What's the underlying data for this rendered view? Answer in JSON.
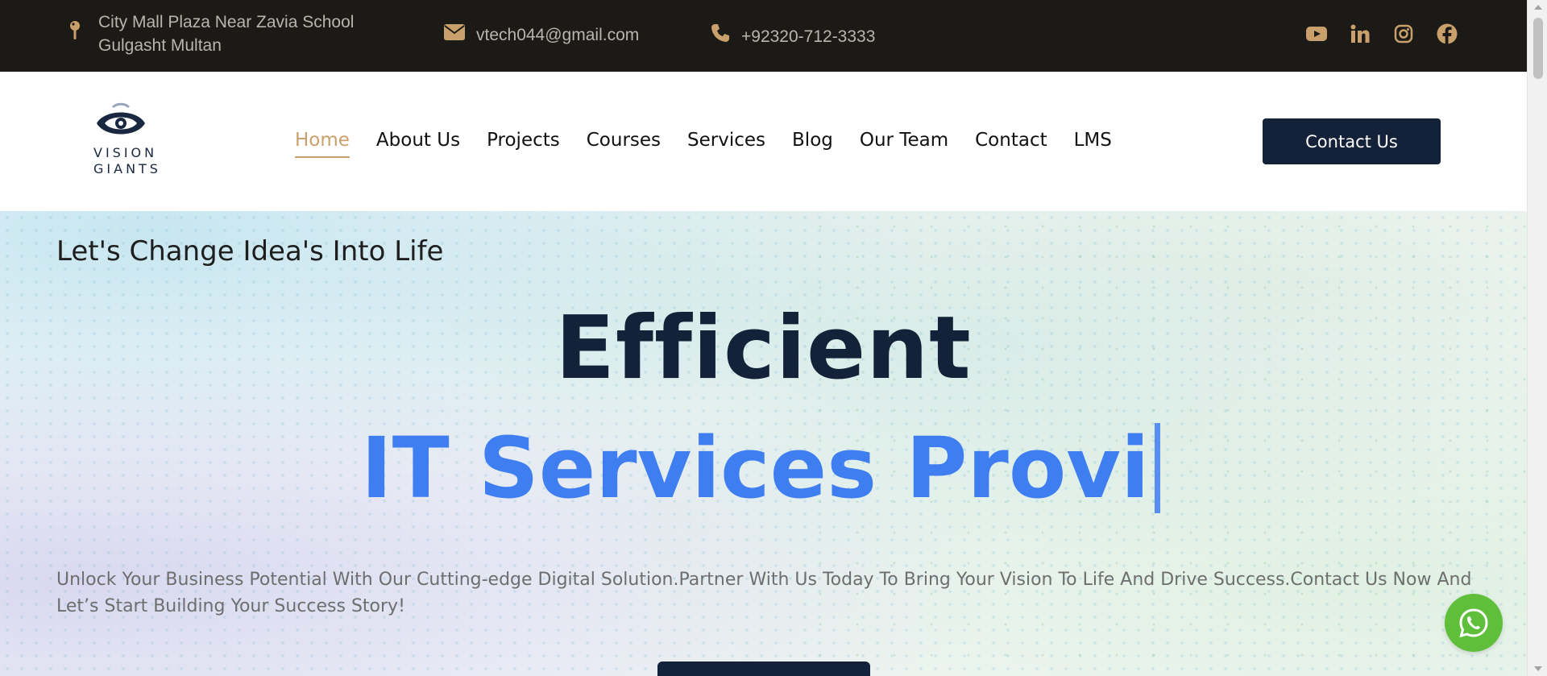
{
  "topbar": {
    "address_line1": "City Mall Plaza Near Zavia School",
    "address_line2": "Gulgasht Multan",
    "email": "vtech044@gmail.com",
    "phone": "+92320-712-3333",
    "social_icons": [
      "youtube-icon",
      "linkedin-icon",
      "instagram-icon",
      "facebook-icon"
    ],
    "icon_color": "#c9a06b",
    "background": "#1b1a17"
  },
  "header": {
    "logo_line1": "VISION",
    "logo_line2": "GIANTS",
    "nav": [
      {
        "label": "Home",
        "active": true
      },
      {
        "label": "About Us"
      },
      {
        "label": "Projects"
      },
      {
        "label": "Courses"
      },
      {
        "label": "Services"
      },
      {
        "label": "Blog"
      },
      {
        "label": "Our Team"
      },
      {
        "label": "Contact"
      },
      {
        "label": "LMS"
      }
    ],
    "cta_label": "Contact Us",
    "active_color": "#c9a06b",
    "brand_color": "#132238"
  },
  "hero": {
    "tagline": "Let's Change Idea's Into Life",
    "headline": "Efficient",
    "typed_text": "IT Services Provi",
    "description": "Unlock Your Business Potential With Our Cutting-edge Digital Solution.Partner With Us Today To Bring Your Vision To Life And Drive Success.Contact Us Now And Let’s Start Building Your Success Story!",
    "accent_color": "#3f7ef0"
  },
  "floating": {
    "whatsapp_icon": "whatsapp-icon",
    "color": "#5fbf3a"
  }
}
